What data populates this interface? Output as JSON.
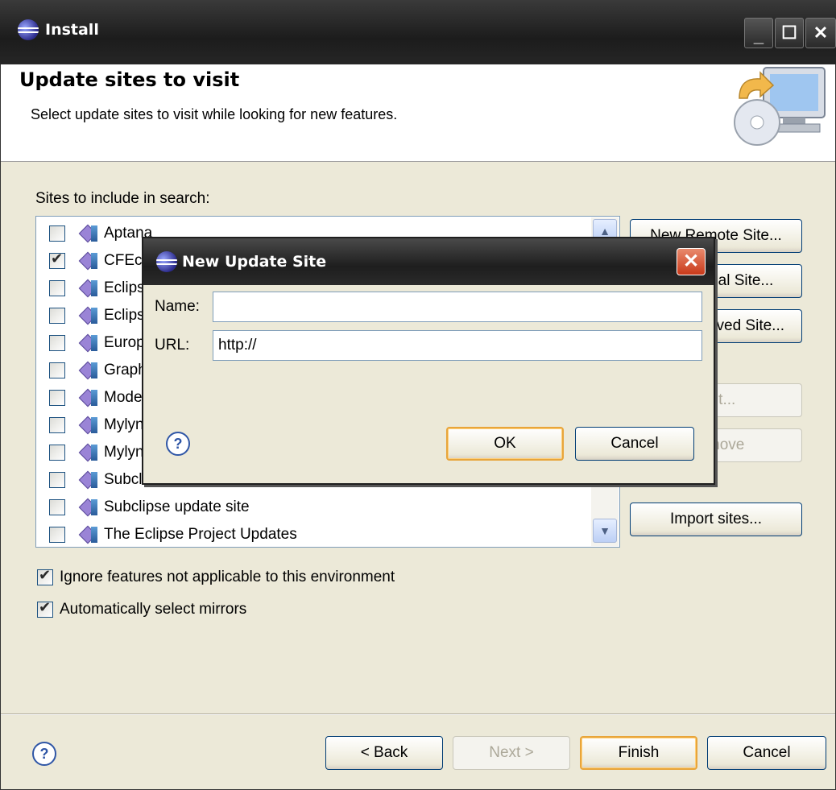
{
  "window": {
    "title": "Install",
    "controls": {
      "minimize": "_",
      "maximize": "☐",
      "close": "✕"
    }
  },
  "header": {
    "title": "Update sites to visit",
    "description": "Select update sites to visit while looking for new features."
  },
  "sites": {
    "label": "Sites to include in search:",
    "items": [
      {
        "label": "Aptana",
        "checked": false
      },
      {
        "label": "CFEclipse",
        "checked": true
      },
      {
        "label": "Eclipse",
        "checked": false
      },
      {
        "label": "Eclipse",
        "checked": false
      },
      {
        "label": "Europa",
        "checked": false
      },
      {
        "label": "Graphical",
        "checked": false
      },
      {
        "label": "Model",
        "checked": false
      },
      {
        "label": "Mylyn",
        "checked": false
      },
      {
        "label": "Mylyn",
        "checked": false
      },
      {
        "label": "Subclipse",
        "checked": false
      },
      {
        "label": "Subclipse update site",
        "checked": false
      },
      {
        "label": "The Eclipse Project Updates",
        "checked": false
      }
    ]
  },
  "side_buttons": {
    "new_remote": "New Remote Site...",
    "new_local": "New Local Site...",
    "new_archived": "New Archived Site...",
    "edit": "Edit...",
    "remove": "Remove",
    "import": "Import sites..."
  },
  "options": {
    "ignore_label": "Ignore features not applicable to this environment",
    "ignore_checked": true,
    "mirrors_label": "Automatically select mirrors",
    "mirrors_checked": true
  },
  "footer": {
    "back": "< Back",
    "next": "Next >",
    "finish": "Finish",
    "cancel": "Cancel",
    "help": "?"
  },
  "dialog": {
    "title": "New Update Site",
    "name_label": "Name:",
    "name_value": "",
    "url_label": "URL:",
    "url_value": "http://",
    "ok": "OK",
    "cancel": "Cancel",
    "help": "?",
    "close": "✕"
  }
}
